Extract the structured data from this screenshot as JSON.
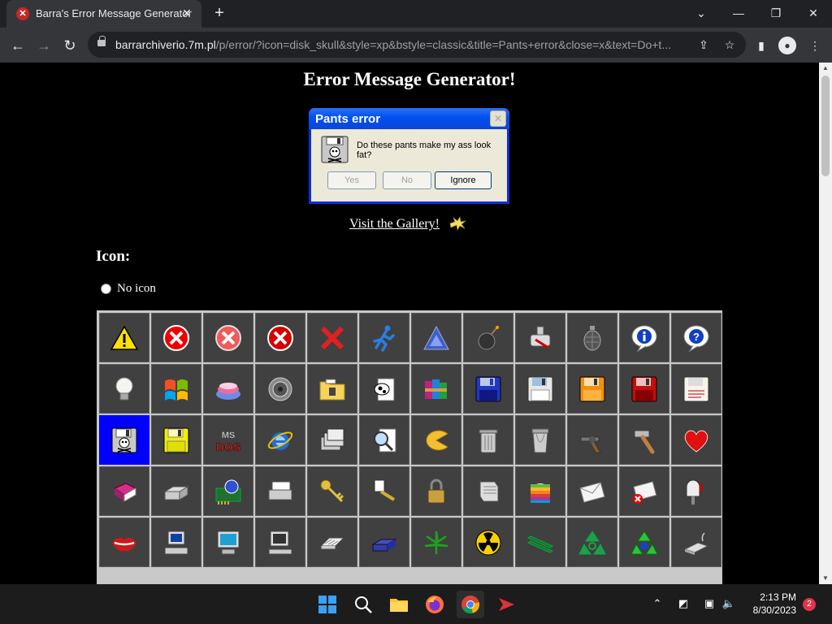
{
  "browser": {
    "tab_title": "Barra's Error Message Generator",
    "tab_favicon": "error-x-icon",
    "url_host": "barrarchiverio.7m.pl",
    "url_path": "/p/error/?icon=disk_skull&style=xp&bstyle=classic&title=Pants+error&close=x&text=Do+t..."
  },
  "page": {
    "heading": "Error Message Generator!",
    "dialog": {
      "title": "Pants error",
      "message": "Do these pants make my ass look fat?",
      "buttons": [
        "Yes",
        "No",
        "Ignore"
      ],
      "close_glyph": "✕"
    },
    "gallery_link": "Visit the Gallery!",
    "icon_section_label": "Icon:",
    "no_icon_label": "No icon",
    "icon_grid": {
      "selected": "floppy-skull-icon",
      "rows": [
        [
          "warning-icon",
          "error-red-x-icon",
          "error-pink-x-icon",
          "error-circle-x-icon",
          "red-x-icon",
          "running-man-icon",
          "triangle-icon",
          "bomb-icon",
          "hammer-tool-icon",
          "grenade-icon",
          "info-balloon-icon",
          "question-balloon-icon"
        ],
        [
          "lightbulb-icon",
          "windows-flag-icon",
          "cake-icon",
          "cd-gear-icon",
          "folder-key-icon",
          "cow-document-icon",
          "winrar-books-icon",
          "floppy-blue-icon",
          "floppy-white-icon",
          "floppy-orange-icon",
          "floppy-red-icon",
          "floppy-document-icon"
        ],
        [
          "floppy-skull-icon",
          "floppy-yellow-icon",
          "msdos-icon",
          "internet-explorer-icon",
          "stacked-disks-icon",
          "magnifier-document-icon",
          "pacman-icon",
          "trash-can-icon",
          "trash-can-full-icon",
          "revolver-icon",
          "hammer-icon",
          "heart-icon"
        ],
        [
          "book-icon",
          "printer-icon",
          "modem-board-icon",
          "scanner-icon",
          "keys-icon",
          "keyring-icon",
          "padlock-icon",
          "printer-paper-icon",
          "apple-logo-icon",
          "envelope-icon",
          "envelope-error-icon",
          "mailbox-icon"
        ],
        [
          "lips-icon",
          "computer-icon",
          "computer-monitor-icon",
          "old-computer-icon",
          "keyboard-icon",
          "modem-icon",
          "cannabis-leaf-icon",
          "radiation-icon",
          "memory-module-icon",
          "recycle-icon",
          "recycle-full-icon",
          "smoking-device-icon"
        ]
      ]
    }
  },
  "taskbar": {
    "apps": [
      "windows-start-icon",
      "search-icon",
      "file-explorer-icon",
      "firefox-icon",
      "chrome-icon",
      "arrow-app-icon"
    ],
    "time": "2:13 PM",
    "date": "8/30/2023",
    "notification_count": "2"
  },
  "colors": {
    "page_bg": "#000000",
    "selected_cell": "#0000ff",
    "xp_title": "#0050ee"
  }
}
